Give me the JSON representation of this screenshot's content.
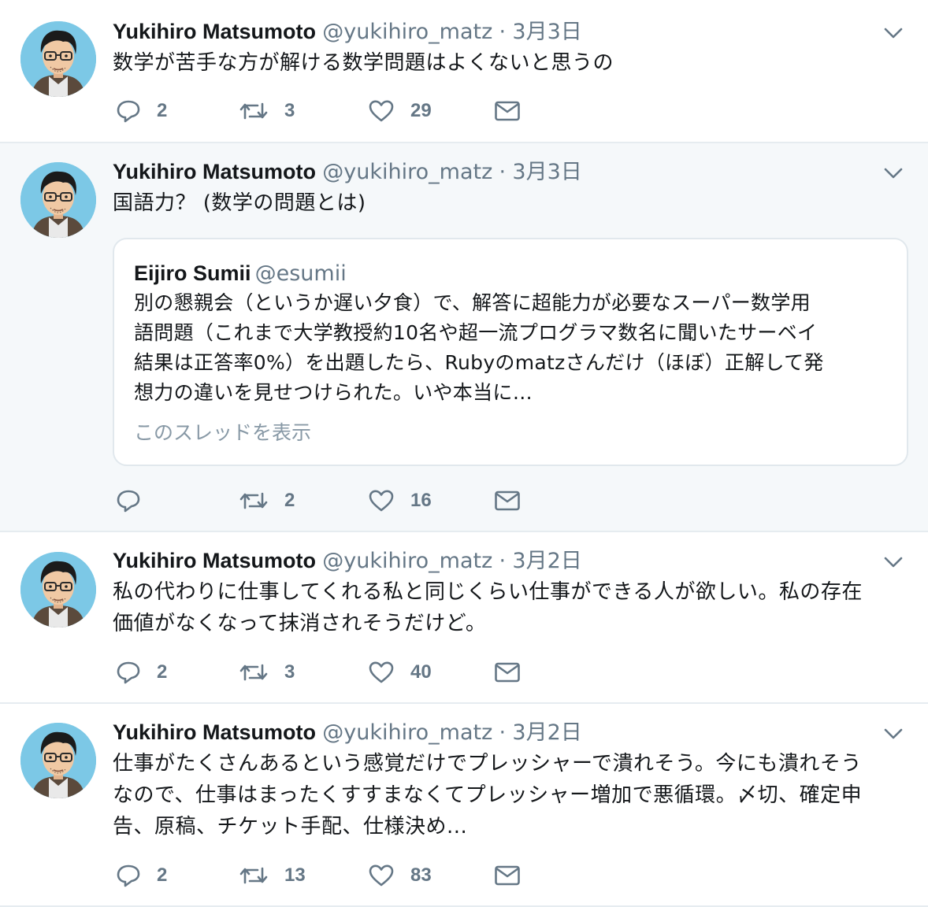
{
  "tweets": [
    {
      "name": "Yukihiro Matsumoto",
      "handle": "@yukihiro_matz",
      "dot": "·",
      "time": "3月3日",
      "lines": [
        "数学が苦手な方が解ける数学問題はよくないと思うの"
      ],
      "replies": "2",
      "retweets": "3",
      "likes": "29"
    },
    {
      "name": "Yukihiro Matsumoto",
      "handle": "@yukihiro_matz",
      "dot": "·",
      "time": "3月3日",
      "lines": [
        "国語力？ (数学の問題とは)"
      ],
      "replies": "",
      "retweets": "2",
      "likes": "16",
      "quote": {
        "name": "Eijiro Sumii",
        "handle": "@esumii",
        "lines": [
          "別の懇親会（というか遅い夕食）で、解答に超能力が必要なスーパー数学用",
          "語問題（これまで大学教授約10名や超一流プログラマ数名に聞いたサーベイ",
          "結果は正答率0%）を出題したら、Rubyのmatzさんだけ（ほぼ）正解して発",
          "想力の違いを見せつけられた。いや本当に…"
        ],
        "thread_link": "このスレッドを表示"
      }
    },
    {
      "name": "Yukihiro Matsumoto",
      "handle": "@yukihiro_matz",
      "dot": "·",
      "time": "3月2日",
      "lines": [
        "私の代わりに仕事してくれる私と同じくらい仕事ができる人が欲しい。私の存在",
        "価値がなくなって抹消されそうだけど。"
      ],
      "replies": "2",
      "retweets": "3",
      "likes": "40"
    },
    {
      "name": "Yukihiro Matsumoto",
      "handle": "@yukihiro_matz",
      "dot": "·",
      "time": "3月2日",
      "lines": [
        "仕事がたくさんあるという感覚だけでプレッシャーで潰れそう。今にも潰れそう",
        "なので、仕事はまったくすすまなくてプレッシャー増加で悪循環。〆切、確定申",
        "告、原稿、チケット手配、仕様決め..."
      ],
      "replies": "2",
      "retweets": "13",
      "likes": "83"
    }
  ],
  "colors": {
    "text": "#14171a",
    "secondary": "#657786",
    "border": "#e6ecf0",
    "highlight_bg": "#f5f8fa",
    "avatar_bg": "#7cc8e6"
  },
  "icons": {
    "reply": "reply-icon",
    "retweet": "retweet-icon",
    "like": "heart-icon",
    "dm": "envelope-icon",
    "caret": "chevron-down-icon"
  }
}
